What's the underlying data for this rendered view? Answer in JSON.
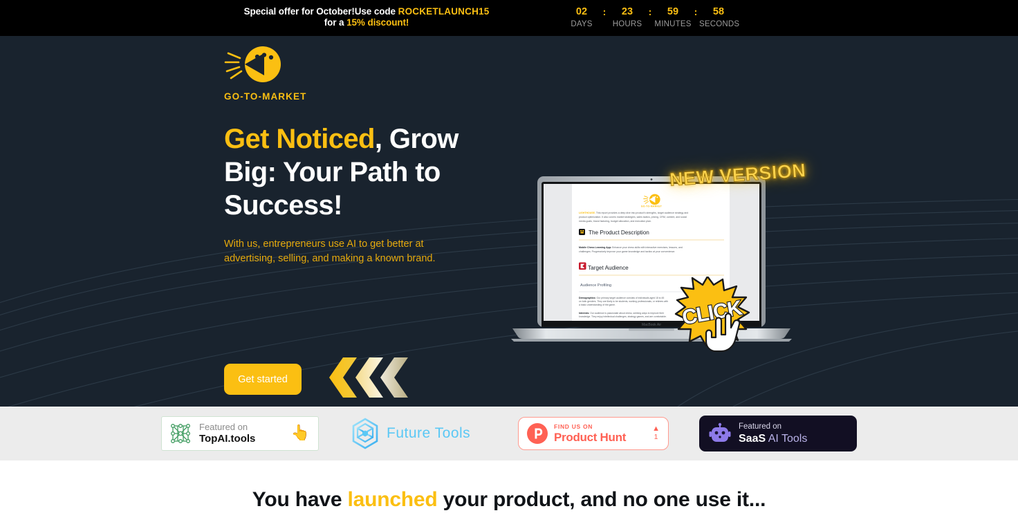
{
  "promo": {
    "line1_prefix": "Special offer for October!Use code ",
    "code": "ROCKETLAUNCH15",
    "line2_prefix": "for a ",
    "discount": "15% discount!",
    "countdown": [
      {
        "value": "02",
        "label": "DAYS"
      },
      {
        "value": "23",
        "label": "HOURS"
      },
      {
        "value": "59",
        "label": "MINUTES"
      },
      {
        "value": "58",
        "label": "SECONDS"
      }
    ],
    "separator": ":"
  },
  "hero": {
    "logo_text": "GO-TO-MARKET",
    "headline_accent": "Get Noticed",
    "headline_rest": ", Grow Big: Your Path to Success!",
    "subtext": "With us, entrepreneurs use AI to get better at advertising, selling, and making a known brand.",
    "cta_label": "Get started",
    "new_version_label": "NEW VERSION",
    "click_label": "CLICK",
    "laptop_model": "MacBook Air",
    "accent_color": "#FBBF12",
    "background_color": "#19232e"
  },
  "document_preview": {
    "logo_text": "GO-TO-MARKET",
    "intro_highlight": "LIGHTHOUSE.",
    "intro_text": "This report provides a deep dive into product's strengths, target audience strategy and product optimization. It also covers market strategies, sales tactics, pricing, CRM, content, and social media goals, brand factoring, budget allocation, and execution plan.",
    "section1_title": "The Product Description",
    "section1_lead": "Mobile Chess Learning App:",
    "section1_text": " Enhance your chess skills with interactive exercises, lessons, and challenges. Progressively improve your game knowledge and tactics at your convenience.",
    "section2_title": "Target Audience",
    "subsection_title": "Audience Profiling",
    "demographics_lead": "Demographics:",
    "demographics_text": " Our primary target audience consists of individuals aged 18 to 45 on both genders. They are likely to be students, working professionals, or retirees with a basic understanding of the game.",
    "interests_lead": "Interests:",
    "interests_text": " Our audience is passionate about chess, seeking ways to improve their skills and knowledge of the game. They enjoy intellectual challenges, strategy games, and are comfortable using mobile apps."
  },
  "badges": [
    {
      "name": "topai",
      "icon": "network-graph-icon",
      "line1": "Featured on",
      "line2": "TopAI.tools",
      "accent": "#3e9b5f"
    },
    {
      "name": "future-tools",
      "icon": "hexagon-aperture-icon",
      "label": "Future Tools",
      "accent": "#5bc8f5"
    },
    {
      "name": "product-hunt",
      "icon": "product-hunt-icon",
      "line1": "FIND US ON",
      "line2": "Product Hunt",
      "vote_count": "1",
      "accent": "#FF6154"
    },
    {
      "name": "saas-ai-tools",
      "icon": "robot-icon",
      "line1": "Featured on",
      "line2_bold": "SaaS",
      "line2_rest": " AI Tools",
      "accent": "#7c6ae0"
    }
  ],
  "bottom": {
    "heading_pre": "You have ",
    "heading_accent": "launched",
    "heading_post": " your product, and no one use it..."
  }
}
